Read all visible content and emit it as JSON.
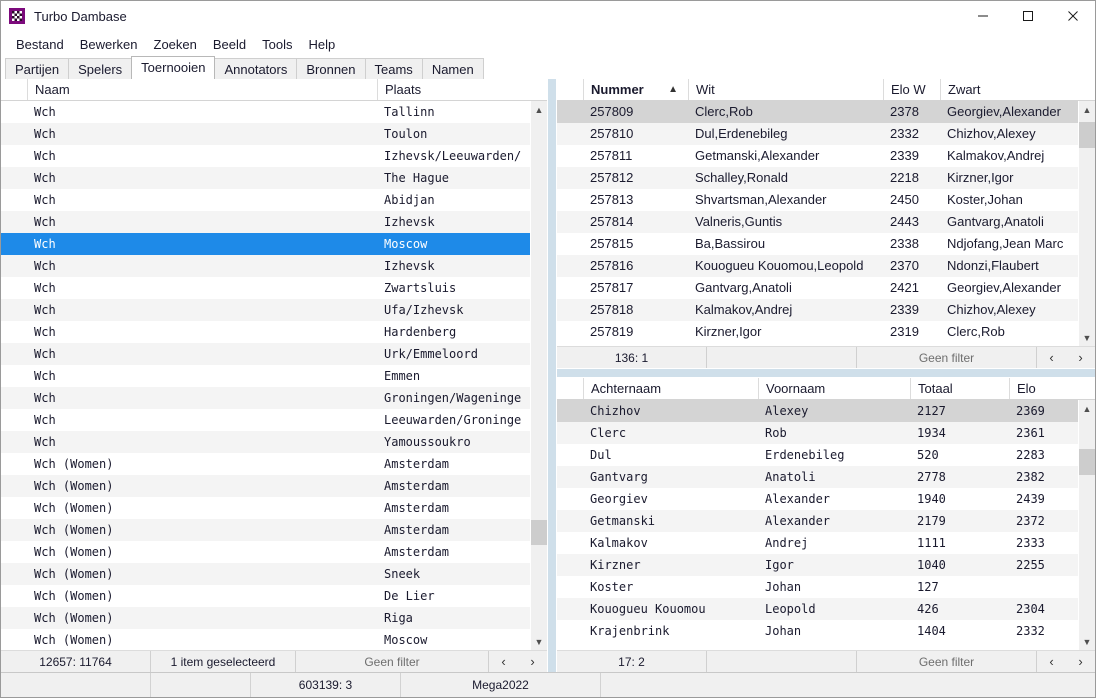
{
  "window": {
    "title": "Turbo Dambase",
    "icon": "checkerboard-icon",
    "controls": {
      "minimize": "minimize-icon",
      "maximize": "maximize-icon",
      "close": "close-icon"
    }
  },
  "menubar": {
    "items": [
      "Bestand",
      "Bewerken",
      "Zoeken",
      "Beeld",
      "Tools",
      "Help"
    ]
  },
  "tabs": {
    "items": [
      "Partijen",
      "Spelers",
      "Toernooien",
      "Annotators",
      "Bronnen",
      "Teams",
      "Namen"
    ],
    "active": "Toernooien"
  },
  "tournaments": {
    "columns": [
      "",
      "Naam",
      "Plaats"
    ],
    "selected_index": 6,
    "rows": [
      {
        "naam": "Wch",
        "plaats": "Tallinn"
      },
      {
        "naam": "Wch",
        "plaats": "Toulon"
      },
      {
        "naam": "Wch",
        "plaats": "Izhevsk/Leeuwarden/"
      },
      {
        "naam": "Wch",
        "plaats": "The Hague"
      },
      {
        "naam": "Wch",
        "plaats": "Abidjan"
      },
      {
        "naam": "Wch",
        "plaats": "Izhevsk"
      },
      {
        "naam": "Wch",
        "plaats": "Moscow"
      },
      {
        "naam": "Wch",
        "plaats": "Izhevsk"
      },
      {
        "naam": "Wch",
        "plaats": "Zwartsluis"
      },
      {
        "naam": "Wch",
        "plaats": "Ufa/Izhevsk"
      },
      {
        "naam": "Wch",
        "plaats": "Hardenberg"
      },
      {
        "naam": "Wch",
        "plaats": "Urk/Emmeloord"
      },
      {
        "naam": "Wch",
        "plaats": "Emmen"
      },
      {
        "naam": "Wch",
        "plaats": "Groningen/Wageninge"
      },
      {
        "naam": "Wch",
        "plaats": "Leeuwarden/Groninge"
      },
      {
        "naam": "Wch",
        "plaats": "Yamoussoukro"
      },
      {
        "naam": "Wch (Women)",
        "plaats": "Amsterdam"
      },
      {
        "naam": "Wch (Women)",
        "plaats": "Amsterdam"
      },
      {
        "naam": "Wch (Women)",
        "plaats": "Amsterdam"
      },
      {
        "naam": "Wch (Women)",
        "plaats": "Amsterdam"
      },
      {
        "naam": "Wch (Women)",
        "plaats": "Amsterdam"
      },
      {
        "naam": "Wch (Women)",
        "plaats": "Sneek"
      },
      {
        "naam": "Wch (Women)",
        "plaats": "De Lier"
      },
      {
        "naam": "Wch (Women)",
        "plaats": "Riga"
      },
      {
        "naam": "Wch (Women)",
        "plaats": "Moscow"
      }
    ],
    "status": {
      "count": "12657: 11764",
      "selection": "1 item geselecteerd",
      "filter": "Geen filter",
      "prev": "‹",
      "next": "›"
    }
  },
  "games": {
    "columns": [
      "",
      "Nummer",
      "Wit",
      "Elo W",
      "Zwart"
    ],
    "sorted_column": "Nummer",
    "sort_direction": "asc",
    "selected_index": 0,
    "rows": [
      {
        "nummer": "257809",
        "wit": "Clerc,Rob",
        "elo_w": "2378",
        "zwart": "Georgiev,Alexander"
      },
      {
        "nummer": "257810",
        "wit": "Dul,Erdenebileg",
        "elo_w": "2332",
        "zwart": "Chizhov,Alexey"
      },
      {
        "nummer": "257811",
        "wit": "Getmanski,Alexander",
        "elo_w": "2339",
        "zwart": "Kalmakov,Andrej"
      },
      {
        "nummer": "257812",
        "wit": "Schalley,Ronald",
        "elo_w": "2218",
        "zwart": "Kirzner,Igor"
      },
      {
        "nummer": "257813",
        "wit": "Shvartsman,Alexander",
        "elo_w": "2450",
        "zwart": "Koster,Johan"
      },
      {
        "nummer": "257814",
        "wit": "Valneris,Guntis",
        "elo_w": "2443",
        "zwart": "Gantvarg,Anatoli"
      },
      {
        "nummer": "257815",
        "wit": "Ba,Bassirou",
        "elo_w": "2338",
        "zwart": "Ndjofang,Jean Marc"
      },
      {
        "nummer": "257816",
        "wit": "Kouogueu Kouomou,Leopold",
        "elo_w": "2370",
        "zwart": "Ndonzi,Flaubert"
      },
      {
        "nummer": "257817",
        "wit": "Gantvarg,Anatoli",
        "elo_w": "2421",
        "zwart": "Georgiev,Alexander"
      },
      {
        "nummer": "257818",
        "wit": "Kalmakov,Andrej",
        "elo_w": "2339",
        "zwart": "Chizhov,Alexey"
      },
      {
        "nummer": "257819",
        "wit": "Kirzner,Igor",
        "elo_w": "2319",
        "zwart": "Clerc,Rob"
      }
    ],
    "status": {
      "count": "136: 1",
      "selection": "",
      "filter": "Geen filter",
      "prev": "‹",
      "next": "›"
    }
  },
  "players": {
    "columns": [
      "",
      "Achternaam",
      "Voornaam",
      "Totaal",
      "Elo"
    ],
    "selected_index": 0,
    "rows": [
      {
        "achternaam": "Chizhov",
        "voornaam": "Alexey",
        "totaal": "2127",
        "elo": "2369"
      },
      {
        "achternaam": "Clerc",
        "voornaam": "Rob",
        "totaal": "1934",
        "elo": "2361"
      },
      {
        "achternaam": "Dul",
        "voornaam": "Erdenebileg",
        "totaal": "520",
        "elo": "2283"
      },
      {
        "achternaam": "Gantvarg",
        "voornaam": "Anatoli",
        "totaal": "2778",
        "elo": "2382"
      },
      {
        "achternaam": "Georgiev",
        "voornaam": "Alexander",
        "totaal": "1940",
        "elo": "2439"
      },
      {
        "achternaam": "Getmanski",
        "voornaam": "Alexander",
        "totaal": "2179",
        "elo": "2372"
      },
      {
        "achternaam": "Kalmakov",
        "voornaam": "Andrej",
        "totaal": "1111",
        "elo": "2333"
      },
      {
        "achternaam": "Kirzner",
        "voornaam": "Igor",
        "totaal": "1040",
        "elo": "2255"
      },
      {
        "achternaam": "Koster",
        "voornaam": "Johan",
        "totaal": "127",
        "elo": ""
      },
      {
        "achternaam": "Kouogueu Kouomou",
        "voornaam": "Leopold",
        "totaal": "426",
        "elo": "2304"
      },
      {
        "achternaam": "Krajenbrink",
        "voornaam": "Johan",
        "totaal": "1404",
        "elo": "2332"
      }
    ],
    "status": {
      "count": "17: 2",
      "selection": "",
      "filter": "Geen filter",
      "prev": "‹",
      "next": "›"
    }
  },
  "mainstatus": {
    "seg1": "",
    "seg2": "",
    "seg3": "603139: 3",
    "seg4": "Mega2022",
    "seg5": ""
  },
  "colors": {
    "selection_blue": "#1e8ae8",
    "selection_gray": "#d4d4d4",
    "splitter": "#cfdfea",
    "row_alt": "#f4f4f4",
    "accent_icon": "#7c0a7c"
  }
}
